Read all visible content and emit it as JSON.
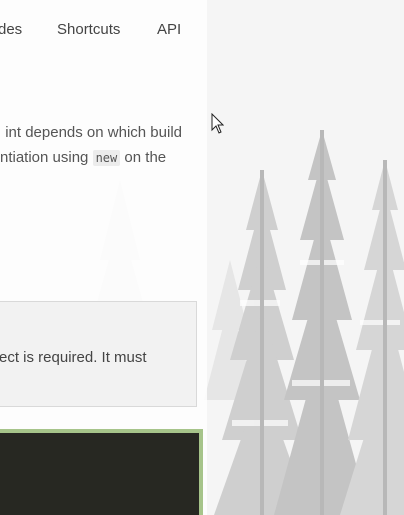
{
  "nav": {
    "items": [
      {
        "label": "des"
      },
      {
        "label": "Shortcuts"
      },
      {
        "label": "API"
      }
    ]
  },
  "main": {
    "paragraph": {
      "line1": "int depends on which build",
      "line2_before": "ntiation using ",
      "line2_code": "new",
      "line2_after": " on the"
    },
    "note": {
      "text": "ect is required. It must"
    }
  },
  "colors": {
    "code_block_bg": "#272822",
    "code_block_border": "#a6c48a"
  },
  "icons": {
    "cursor": "mouse-pointer-icon"
  }
}
